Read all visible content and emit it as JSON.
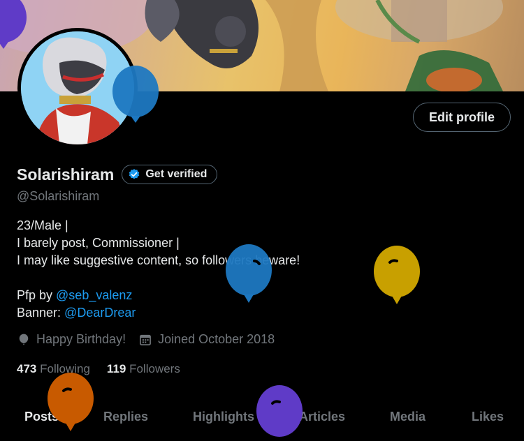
{
  "profile": {
    "display_name": "Solarishiram",
    "handle": "@Solarishiram",
    "edit_label": "Edit profile",
    "verify_label": "Get verified"
  },
  "bio": {
    "line1": "23/Male |",
    "line2": "I barely post, Commissioner |",
    "line3": "I may like suggestive content, so followers beware!",
    "pfp_prefix": "Pfp by ",
    "pfp_link": "@seb_valenz",
    "banner_prefix": "Banner: ",
    "banner_link": "@DearDrear"
  },
  "meta": {
    "birthday": "Happy Birthday!",
    "joined": "Joined October 2018"
  },
  "stats": {
    "following_count": "473",
    "following_label": "Following",
    "followers_count": "119",
    "followers_label": "Followers"
  },
  "tabs": [
    "Posts",
    "Replies",
    "Highlights",
    "Articles",
    "Media",
    "Likes"
  ],
  "colors": {
    "accent": "#1d9bf0",
    "background": "#000000",
    "muted": "#71767b",
    "border": "#536471",
    "balloon_blue": "#1d78c1",
    "balloon_gold": "#c8a000",
    "balloon_orange": "#c85a00",
    "balloon_purple": "#5f3bc7"
  },
  "icons": {
    "verified": "verified-badge-icon",
    "birthday": "balloon-icon",
    "joined": "calendar-icon"
  }
}
